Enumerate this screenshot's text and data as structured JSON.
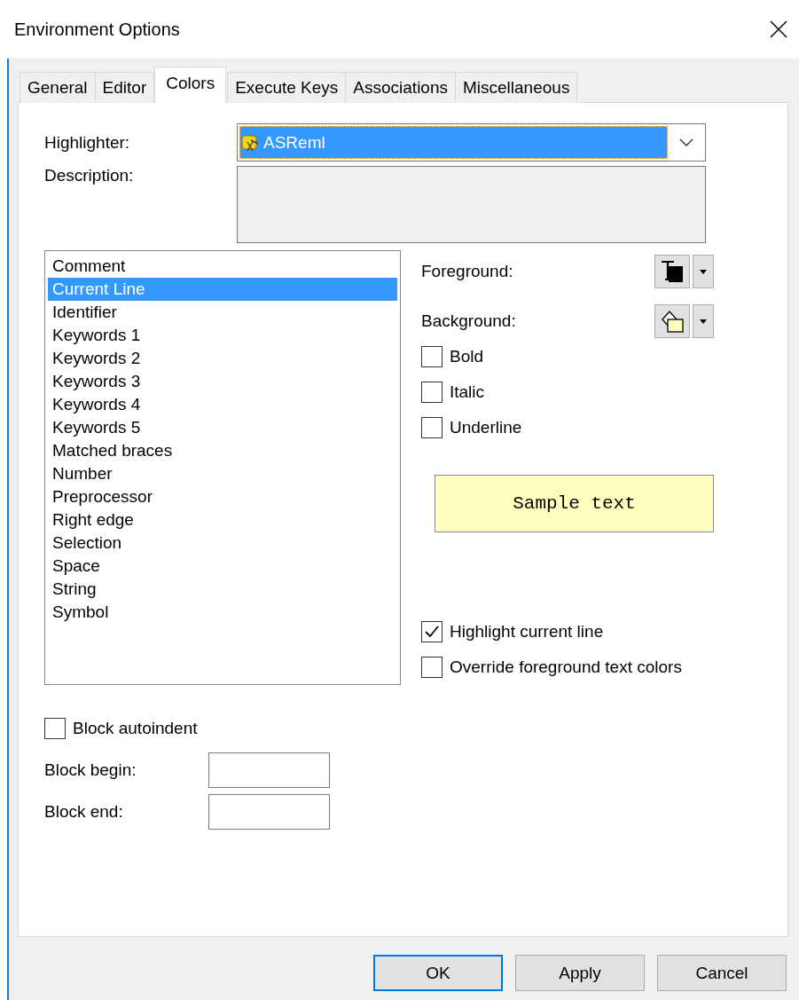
{
  "window": {
    "title": "Environment Options"
  },
  "tabs": [
    {
      "label": "General",
      "selected": false
    },
    {
      "label": "Editor",
      "selected": false
    },
    {
      "label": "Colors",
      "selected": true
    },
    {
      "label": "Execute Keys",
      "selected": false
    },
    {
      "label": "Associations",
      "selected": false
    },
    {
      "label": "Miscellaneous",
      "selected": false
    }
  ],
  "highlighter": {
    "label": "Highlighter:",
    "value": "ASReml"
  },
  "description": {
    "label": "Description:"
  },
  "elements": [
    {
      "label": "Comment",
      "selected": false
    },
    {
      "label": "Current Line",
      "selected": true
    },
    {
      "label": "Identifier",
      "selected": false
    },
    {
      "label": "Keywords 1",
      "selected": false
    },
    {
      "label": "Keywords 2",
      "selected": false
    },
    {
      "label": "Keywords 3",
      "selected": false
    },
    {
      "label": "Keywords 4",
      "selected": false
    },
    {
      "label": "Keywords 5",
      "selected": false
    },
    {
      "label": "Matched braces",
      "selected": false
    },
    {
      "label": "Number",
      "selected": false
    },
    {
      "label": "Preprocessor",
      "selected": false
    },
    {
      "label": "Right edge",
      "selected": false
    },
    {
      "label": "Selection",
      "selected": false
    },
    {
      "label": "Space",
      "selected": false
    },
    {
      "label": "String",
      "selected": false
    },
    {
      "label": "Symbol",
      "selected": false
    }
  ],
  "foreground": {
    "label": "Foreground:"
  },
  "background": {
    "label": "Background:"
  },
  "styles": [
    {
      "label": "Bold",
      "checked": false
    },
    {
      "label": "Italic",
      "checked": false
    },
    {
      "label": "Underline",
      "checked": false
    }
  ],
  "sample": {
    "text": "Sample text"
  },
  "options": [
    {
      "label": "Highlight current line",
      "checked": true
    },
    {
      "label": "Override foreground text colors",
      "checked": false
    }
  ],
  "block_autoindent": {
    "label": "Block autoindent",
    "checked": false
  },
  "block_fields": [
    {
      "label": "Block begin:"
    },
    {
      "label": "Block end:"
    }
  ],
  "buttons": [
    {
      "label": "OK",
      "default": true
    },
    {
      "label": "Apply",
      "default": false
    },
    {
      "label": "Cancel",
      "default": false
    }
  ]
}
